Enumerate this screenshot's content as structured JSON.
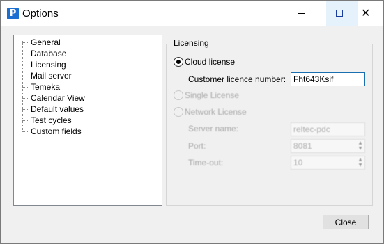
{
  "window": {
    "title": "Options",
    "app_icon_letter": "P"
  },
  "titlebar": {
    "close_glyph": "✕"
  },
  "tree": {
    "items": [
      "General",
      "Database",
      "Licensing",
      "Mail server",
      "Temeka",
      "Calendar View",
      "Default values",
      "Test cycles",
      "Custom fields"
    ],
    "selected": "Licensing"
  },
  "licensing": {
    "group_title": "Licensing",
    "cloud_label": "Cloud license",
    "customer_label": "Customer licence number:",
    "customer_value": "Fht643Ksif",
    "single_label": "Single License",
    "network_label": "Network License",
    "server_label": "Server name:",
    "server_value": "reltec-pdc",
    "port_label": "Port:",
    "port_value": "8081",
    "timeout_label": "Time-out:",
    "timeout_value": "10"
  },
  "footer": {
    "close_label": "Close"
  },
  "colors": {
    "accent": "#1a6fb0",
    "app_icon": "#1b6fd0",
    "max_hover": "#e5f1fb"
  }
}
